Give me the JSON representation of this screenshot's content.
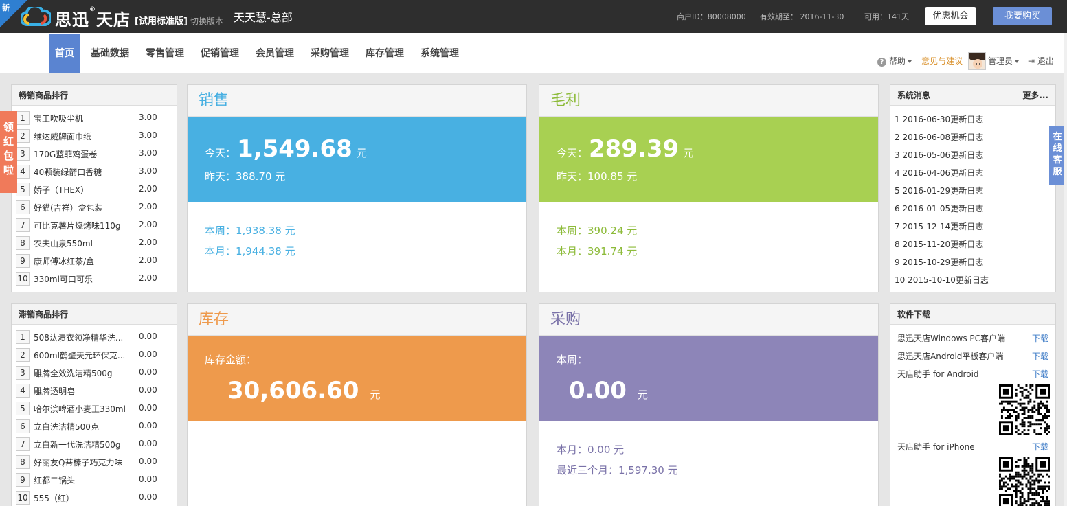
{
  "topbar": {
    "badge": "新",
    "brand": "思迅",
    "brand_reg": "®",
    "brand_suffix": "天店",
    "edition": "[试用标准版]",
    "switch_label": "切换版本",
    "store_name": "天天慧-总部",
    "merchant_id": "商户ID：80008000",
    "valid_until": "有效期至： 2016-11-30",
    "available": "可用：141天",
    "promo_button": "优惠机会",
    "buy_button": "我要购买"
  },
  "nav": {
    "items": [
      "首页",
      "基础数据",
      "零售管理",
      "促销管理",
      "会员管理",
      "采购管理",
      "库存管理",
      "系统管理"
    ],
    "help": "帮助",
    "feedback": "意见与建议",
    "user": "管理员",
    "logout": "退出"
  },
  "colors": {
    "sales": "#48b0e2",
    "profit": "#a8d052",
    "stock": "#ee9a4c",
    "purchase": "#8d85b8",
    "nav_active": "#5a84d1"
  },
  "bestsellers": {
    "title": "畅销商品排行",
    "rows": [
      {
        "rank": "1",
        "name": "宝工吹吸尘机",
        "value": "3.00"
      },
      {
        "rank": "2",
        "name": "维达威牌面巾纸",
        "value": "3.00"
      },
      {
        "rank": "3",
        "name": "170G蓝菲鸡蛋卷",
        "value": "3.00"
      },
      {
        "rank": "4",
        "name": "40颗装绿箭口香糖",
        "value": "3.00"
      },
      {
        "rank": "5",
        "name": "娇子（THEX）",
        "value": "2.00"
      },
      {
        "rank": "6",
        "name": "好猫(吉祥）盒包装",
        "value": "2.00"
      },
      {
        "rank": "7",
        "name": "可比克薯片烧烤味110g",
        "value": "2.00"
      },
      {
        "rank": "8",
        "name": "农夫山泉550ml",
        "value": "2.00"
      },
      {
        "rank": "9",
        "name": "康师傅冰红茶/盒",
        "value": "2.00"
      },
      {
        "rank": "10",
        "name": "330ml可口可乐",
        "value": "2.00"
      }
    ]
  },
  "slowsellers": {
    "title": "滞销商品排行",
    "rows": [
      {
        "rank": "1",
        "name": "508汰渍衣领净精华洗...",
        "value": "0.00"
      },
      {
        "rank": "2",
        "name": "600ml鹤壁天元环保克...",
        "value": "0.00"
      },
      {
        "rank": "3",
        "name": "雕牌全效洗洁精500g",
        "value": "0.00"
      },
      {
        "rank": "4",
        "name": "雕牌透明皂",
        "value": "0.00"
      },
      {
        "rank": "5",
        "name": "哈尔滨啤酒小麦王330ml",
        "value": "0.00"
      },
      {
        "rank": "6",
        "name": "立白洗洁精500克",
        "value": "0.00"
      },
      {
        "rank": "7",
        "name": "立白新一代洗洁精500g",
        "value": "0.00"
      },
      {
        "rank": "8",
        "name": "好丽友Q蒂榛子巧克力味",
        "value": "0.00"
      },
      {
        "rank": "9",
        "name": "红都二锅头",
        "value": "0.00"
      },
      {
        "rank": "10",
        "name": "555（红）",
        "value": "0.00"
      }
    ]
  },
  "sales": {
    "title": "销售",
    "today_label": "今天：",
    "today_value": "1,549.68",
    "unit": "元",
    "yesterday": "昨天：388.70 元",
    "week": "本周：1,938.38 元",
    "month": "本月：1,944.38 元"
  },
  "profit": {
    "title": "毛利",
    "today_label": "今天：",
    "today_value": "289.39",
    "unit": "元",
    "yesterday": "昨天：100.85 元",
    "week": "本周：390.24 元",
    "month": "本月：391.74 元"
  },
  "stock": {
    "title": "库存",
    "label": "库存金额：",
    "value": "30,606.60",
    "unit": "元"
  },
  "purchase": {
    "title": "采购",
    "label": "本周：",
    "value": "0.00",
    "unit": "元",
    "month": "本月：0.00 元",
    "three_months": "最近三个月：1,597.30 元"
  },
  "messages": {
    "title": "系统消息",
    "more": "更多...",
    "items": [
      "1 2016-06-30更新日志",
      "2 2016-06-08更新日志",
      "3 2016-05-06更新日志",
      "4 2016-04-06更新日志",
      "5 2016-01-29更新日志",
      "6 2016-01-05更新日志",
      "7 2015-12-14更新日志",
      "8 2015-11-20更新日志",
      "9 2015-10-29更新日志",
      "10 2015-10-10更新日志"
    ]
  },
  "downloads": {
    "title": "软件下载",
    "link_label": "下载",
    "items": [
      "思迅天店Windows PC客户端",
      "思迅天店Android平板客户端",
      "天店助手 for Android",
      "天店助手 for iPhone"
    ]
  },
  "side": {
    "left_tab": "领红包啦",
    "right_tab": "在线客服"
  }
}
